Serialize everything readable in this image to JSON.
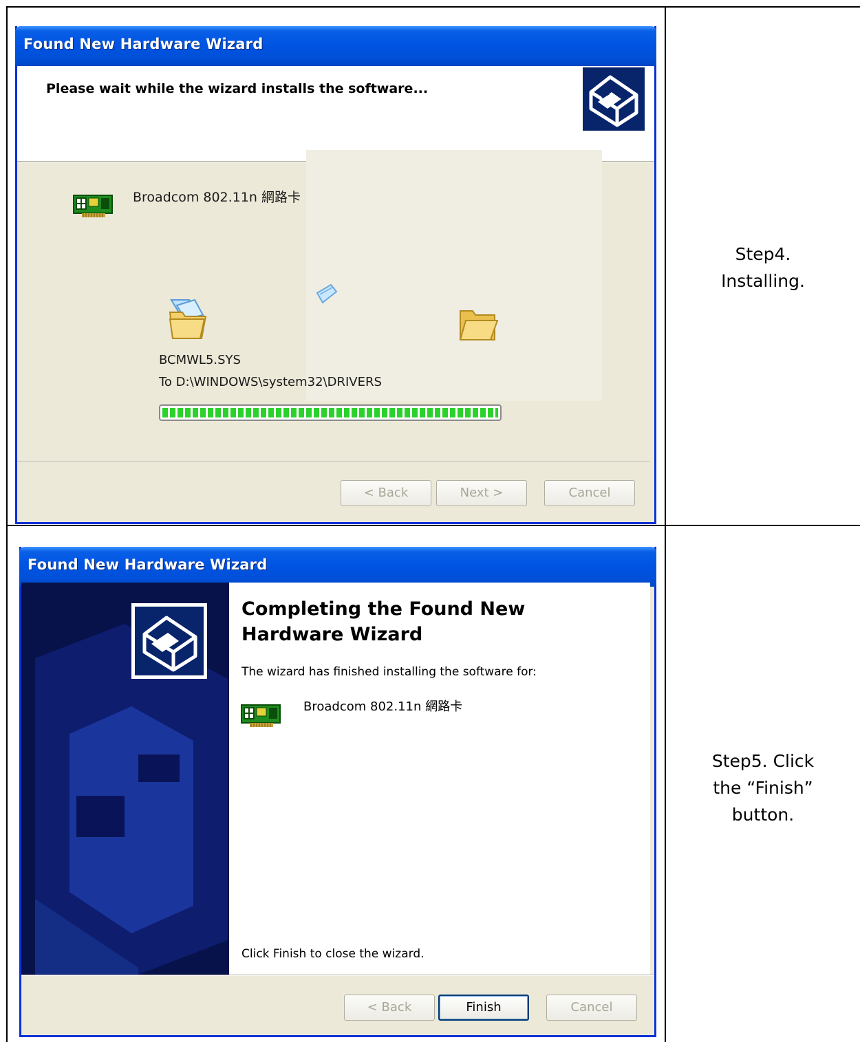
{
  "rows": [
    {
      "step_text": "Step4.\nInstalling.",
      "window": {
        "title": "Found New Hardware Wizard",
        "header_text": "Please wait while the wizard installs the software...",
        "device_name": "Broadcom 802.11n 網路卡",
        "file_name": "BCMWL5.SYS",
        "destination": "To D:\\WINDOWS\\system32\\DRIVERS",
        "progress_fraction": 1.0,
        "buttons": {
          "back": "< Back",
          "next": "Next >",
          "cancel": "Cancel"
        }
      }
    },
    {
      "step_text": "Step5. Click\nthe “Finish”\nbutton.",
      "window": {
        "title": "Found New Hardware Wizard",
        "heading": "Completing the Found New\nHardware Wizard",
        "finished_text": "The wizard has finished installing the software for:",
        "device_name": "Broadcom 802.11n 網路卡",
        "close_text": "Click Finish to close the wizard.",
        "buttons": {
          "back": "< Back",
          "finish": "Finish",
          "cancel": "Cancel"
        }
      }
    }
  ],
  "icons": {
    "network_card": "network-card-icon",
    "wizard": "hardware-wizard-icon",
    "folder_source": "folder-source-icon",
    "folder_dest": "folder-dest-icon",
    "flying_paper": "flying-paper-icon"
  },
  "colors": {
    "titlebar": "#0054e3",
    "window_bg": "#ece9d8",
    "progress": "#2bd22b",
    "banner": "#07124a"
  }
}
